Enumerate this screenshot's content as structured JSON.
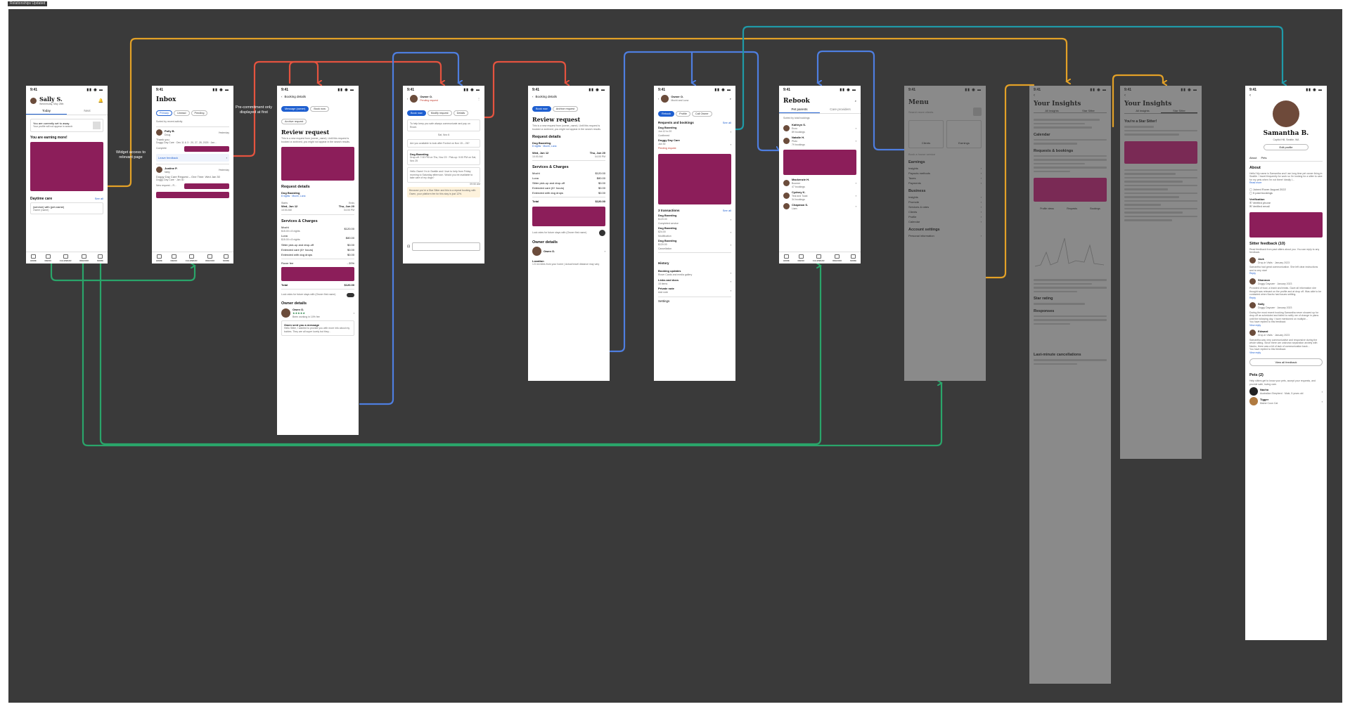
{
  "canvas_tag": "Relationships Updated",
  "notes": {
    "widget": "Widget access to relevant page",
    "precommit": "Pre-commitment only displayed at first"
  },
  "colors": {
    "orange": "#e3a127",
    "red": "#e5533f",
    "blue": "#4e7ee0",
    "teal": "#1f9aa8",
    "green": "#2aa56a",
    "accent": "#8c1e5a"
  },
  "home": {
    "name": "Sally S.",
    "date": "Wednesday, May 28th",
    "tabs": [
      "Today",
      "Next"
    ],
    "away": "You are currently set to away.",
    "away_sub": "Your profile will not appear in search",
    "earning": "You are earning more!",
    "daytime": "Daytime care",
    "see_all": "See all",
    "service": "(service) with (pet-name)",
    "service_sub": "Owner (name)",
    "nav": [
      "HOME",
      "INBOX",
      "CALENDAR",
      "REBOOK",
      "MORE"
    ]
  },
  "inbox": {
    "title": "Inbox",
    "filters": [
      "Primary",
      "Unread",
      "Pending"
    ],
    "sorted": "Sorted by recent activity",
    "m1_name": "Polly B.",
    "m1_sub": "Doug",
    "m1_date": "Yesterday",
    "m1_text": "Thank you",
    "m1_line": "Doggy Day Care · Dec 11 & 3 · 20, 27, 28, 2025 · Jan...",
    "m1_status": "Complete",
    "leave_feedback": "Leave feedback",
    "m2_name": "Justine P.",
    "m2_sub": "Nelly",
    "m2_date": "Yesterday",
    "m2_text": "Doggy Day Care Request – One Time: Wed Jan 30",
    "m2_line": "Doggy Day Care · Jan 30",
    "m2_status": "New request – R..."
  },
  "booking": {
    "header": "Booking details",
    "chips": [
      "Message (owner)",
      "Book now",
      "Archive request"
    ],
    "title": "Review request",
    "body": "This is a new request from (owner_name). Until this request is booked or archived, you might not appear in the search results.",
    "req_details": "Request details",
    "service": "Dog Boarding",
    "nights": "8 nights · Mochi, Luna",
    "starts_l": "Starts",
    "ends_l": "Ends",
    "starts": "Wed, Jun 12",
    "starts_t": "10:00 AM",
    "ends": "Thu, Jun 20",
    "ends_t": "04:00 PM",
    "svc_charges": "Services & Charges",
    "mochi": "Mochi",
    "mochi_d": "$15.00 x 8 nights",
    "mochi_v": "$120.00",
    "luna": "Luna",
    "luna_d": "$15.00 x 8 nights",
    "luna_v": "$80.00",
    "pickup": "Sitter pick-up and drop-off",
    "pickup_v": "$0.00",
    "extended": "Extended care (6+ hours)",
    "extended_v": "$0.00",
    "extended2": "Extended with dog drops",
    "extended2_v": "$0.00",
    "rover_fee": "Rover fee",
    "rover_fee_v": "- 20%",
    "total": "Total",
    "total_v": "$120.00",
    "lock": "Lock rates for future stays with (Owner first name)",
    "owner_details": "Owner details",
    "owner": "Owen O.",
    "owner_sub": "Been working in 10% fee",
    "owner_msg": "Owen sent you a message",
    "owner_msg_body": "Hello Sitter, I wanted to provide you with more info about my babies. They are all super lovely but they..."
  },
  "chat": {
    "name": "Owner O.",
    "status": "Pending request",
    "chips": [
      "Book now",
      "Modify request",
      "Details"
    ],
    "tip": "To help keep you safe always communicate and pay on Rover.",
    "day": "Sat, Nov 6",
    "q1": "Are you available to look after Foxtrot on Nov 15 – 26?",
    "card": "Dog Boarding",
    "card_sub": "Drop-off: 7:00 PM on Thu, Nov 23 · Pick-up: 9:00 PM on Sat, Nov 25",
    "reply": "Hello Owen! I'm in Seattle and I love to help from Friday morning to Saturday afternoon. Would you be available to take care of my dogs?",
    "reply_time": "09:50 AM",
    "star": "Because you're a Star Sitter and this is a repeat booking with Owen, your platform fee for this stay is just 12%."
  },
  "booking2": {
    "header": "Booking details",
    "chips": [
      "Book now",
      "Archive request"
    ],
    "title": "Review request",
    "body": "This is a new request from (owner_name). Until this request is booked or archived, you might not appear in the search results.",
    "req_details": "Request details",
    "service": "Dog Boarding",
    "nights": "8 nights · Mochi, Luna",
    "starts": "Wed, Jun 12",
    "starts_t": "10:00 AM",
    "ends": "Thu, Jun 20",
    "ends_t": "04:00 PM",
    "svc_charges": "Services & Charges",
    "mochi": "Mochi",
    "mochi_v": "$120.00",
    "luna": "Luna",
    "luna_v": "$80.00",
    "pickup": "Sitter pick-up and drop-off",
    "pickup_v": "$0.00",
    "extended": "Extended care (6+ hours)",
    "extended_v": "$0.00",
    "extended2": "Extended with dog drops",
    "extended2_v": "$0.00",
    "total": "Total",
    "total_v": "$120.00",
    "lock": "Lock rates for future stays with (Owner first name)",
    "owner_details": "Owner details",
    "owner": "Owen O.",
    "location": "Location",
    "location_sub": "1.5 mi miles from your home | Actual travel distance may vary"
  },
  "client": {
    "name": "Owner O.",
    "sub": "Mochi and Luna",
    "chips": [
      "Rebook",
      "Profile",
      "Call Owner"
    ],
    "req_book": "Requests and bookings",
    "see_all": "See all",
    "b1": "Dog Boarding",
    "b1_d": "Jun 12 to 20",
    "b1_s": "Confirmed",
    "b2": "Doggy Day Care",
    "b2_d": "Jan 30",
    "b2_s": "Pending request",
    "tx": "3 transactions",
    "tx_see": "See all",
    "t1": "Dog Boarding",
    "t1_d": "$120.00",
    "t1_s": "Completed service",
    "t2": "Dog Boarding",
    "t2_d": "$24.00",
    "t2_s": "Modification",
    "t3": "Dog Boarding",
    "t3_d": "$120.00",
    "t3_s": "Cancellation",
    "history": "History",
    "h1": "Booking updates",
    "h1_s": "Rover Cards and media gallery",
    "h2": "Links and docs",
    "h2_s": "15 items",
    "h3": "Private note",
    "h3_s": "Add note",
    "settings": "Settings"
  },
  "rebook": {
    "title": "Rebook",
    "tabs": [
      "Pet parents",
      "Care providers"
    ],
    "sorted": "Sorted by total bookings",
    "p1": "Kathryn S.",
    "p1_pet": "Enzo",
    "p1_s": "89 bookings",
    "p2": "Natalie H.",
    "p2_pet": "Pluto",
    "p2_s": "79 bookings",
    "p3": "Mackenzie H.",
    "p3_pet": "Boomer",
    "p3_s": "47 bookings",
    "p4": "Cydney K.",
    "p4_pet": "Teal and Toast",
    "p4_s": "34 bookings",
    "p5": "Chapman S.",
    "p5_pet": "Liam",
    "nav": [
      "HOME",
      "INBOX",
      "CALENDAR",
      "REBOOK",
      "MORE"
    ]
  },
  "menu": {
    "title": "Menu",
    "search": "Search more clients",
    "tile1": "Clients",
    "tile2": "Earnings",
    "bonus": "Book a house service",
    "earnings": "Earnings",
    "e1": "Insights",
    "e2": "Payouts methods",
    "e3": "Taxes",
    "e4": "Payments",
    "business": "Business",
    "b1": "Insights",
    "b2": "Promote",
    "b3": "Services & rates",
    "b4": "Clients",
    "b5": "Profile",
    "b6": "Calendar",
    "account": "Account settings",
    "a1": "Personal information"
  },
  "insights": {
    "title": "Your Insights",
    "tabs": [
      "All Insights",
      "Star Sitter"
    ],
    "calendar": "Calendar",
    "req_book": "Requests & bookings",
    "chart_tabs": [
      "Profile views",
      "Requests",
      "Bookings"
    ],
    "star_rating": "Star rating",
    "responses": "Responses",
    "last_min": "Last-minute cancellations"
  },
  "starsitter": {
    "title": "Your Insights",
    "tabs": [
      "All Insights",
      "Star Sitter"
    ],
    "banner": "You're a Star Sitter!"
  },
  "profile": {
    "name": "Samantha B.",
    "loc": "Capitol Hill, Seattle, WA",
    "edit": "Edit profile",
    "tabs": [
      "About",
      "Pets"
    ],
    "about": "About",
    "about_body": "Hello! My name is Samantha and I am long time pet owner living in Seattle. I travel frequently for work so I'm looking for a sitter to care for my pets when I'm not there! Ideally I...",
    "read_more": "Read more",
    "joined": "Joined Rover August 2022",
    "past": "5 past bookings",
    "verification": "Verification",
    "v1": "Verified phone",
    "v2": "Verified email",
    "feedback": "Sitter feedback (10)",
    "feedback_sub": "Read feedback from past sitters about you. You can reply to any feedback.",
    "f1": "Jack",
    "f1_sub": "Drop-in Visits · January 2023",
    "f1_body": "Samantha had great communication. She left clear instructions and is very nice!",
    "f1_reply": "Reply",
    "f2": "Shannon",
    "f2_sub": "Doggy Daycare · January 2023",
    "f2_body": "Provided of food, a leash and treats. Gave all information she thought was relevant on the profile and at drop off. Was able to be contacted when Nacho had issues settling.",
    "f2_reply": "Reply",
    "f3": "Sally",
    "f3_sub": "Doggy Daycare · January 2023",
    "f3_body": "During the most recent booking Samantha never showed up for drop-off as scheduled and failed to notify me of change in plans until the following day. I have mentioned on multiple...",
    "f3_note": "You have replied to this feedback",
    "f3_view": "View reply",
    "f4": "Edward",
    "f4_sub": "Drop-in Visits · January 2023",
    "f4_body": "Samantha was very communicative and responsive during the whole sitting. Since there are unknown separation anxiety with Nacho, there was a bit of lack of communication back...",
    "f4_note": "You have replied to this feedback",
    "f4_view": "View reply",
    "view_all": "View all feedback",
    "pets": "Pets (2)",
    "pets_sub": "Help sitters get to know your pets, accept your requests, and provide safe, loving care.",
    "pet1": "Nacho",
    "pet1_sub": "Australian Shepherd · Male, 5 years old",
    "pet2": "Tigger",
    "pet2_sub": "Maine Coon Cat"
  },
  "time": "9:41"
}
